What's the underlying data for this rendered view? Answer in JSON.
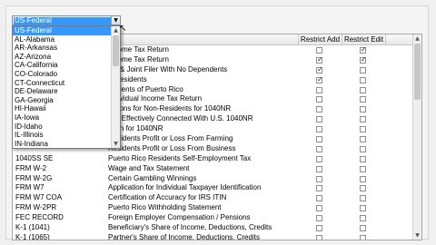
{
  "combo": {
    "selected": "US-Federal",
    "arrow_icon": "chevron-down-icon"
  },
  "dropdown": {
    "items": [
      "US-Federal",
      "AL-Alabama",
      "AR-Arkansas",
      "AZ-Arizona",
      "CA-California",
      "CO-Colorado",
      "CT-Connecticut",
      "DE-Delaware",
      "GA-Georgia",
      "HI-Hawaii",
      "IA-Iowa",
      "ID-Idaho",
      "IL-Illinois",
      "IN-Indiana"
    ],
    "selected_index": 0
  },
  "grid": {
    "headers": {
      "code": "",
      "description": "",
      "restrict_add": "Restrict Add",
      "restrict_edit": "Restrict Edit"
    },
    "rows": [
      {
        "code": "",
        "desc": "Income Tax Return",
        "add": false,
        "edit": true
      },
      {
        "code": "",
        "desc": "Income Tax Return",
        "add": true,
        "edit": true
      },
      {
        "code": "",
        "desc": "gle & Joint Filer With No Dependents",
        "add": true,
        "edit": false
      },
      {
        "code": "",
        "desc": "n-Residents",
        "add": true,
        "edit": false
      },
      {
        "code": "",
        "desc": "esidents of Puerto Rico",
        "add": false,
        "edit": false
      },
      {
        "code": "",
        "desc": "Individual Income Tax Return",
        "add": false,
        "edit": false
      },
      {
        "code": "",
        "desc": "uctions for Non-Residents for 1040NR",
        "add": false,
        "edit": false
      },
      {
        "code": "",
        "desc": "Not Effectively Connected With U.S. 1040NR",
        "add": false,
        "edit": false
      },
      {
        "code": "",
        "desc": "ation for 1040NR",
        "add": false,
        "edit": false
      },
      {
        "code": "",
        "desc": "Residents Profit or Loss From Farming",
        "add": false,
        "edit": false
      },
      {
        "code": "",
        "desc": "Residents Profit or Loss From Business",
        "add": false,
        "edit": false
      },
      {
        "code": "1040SS SE",
        "desc": "Puerto Rico Residents Self-Employment Tax",
        "add": false,
        "edit": false
      },
      {
        "code": "FRM W-2",
        "desc": "Wage and Tax Statement",
        "add": false,
        "edit": false
      },
      {
        "code": "FRM W-2G",
        "desc": "Certain Gambling Winnings",
        "add": false,
        "edit": false
      },
      {
        "code": "FRM W7",
        "desc": "Application for Individual Taxpayer Identification",
        "add": false,
        "edit": false
      },
      {
        "code": "FRM W7 COA",
        "desc": "Certification of Accuracy for IRS ITIN",
        "add": false,
        "edit": false
      },
      {
        "code": "FRM W-2PR",
        "desc": "Puerto Rico Withholding Statement",
        "add": false,
        "edit": false
      },
      {
        "code": "FEC RECORD",
        "desc": "Foreign Employer Compensation / Pensions",
        "add": false,
        "edit": false
      },
      {
        "code": "K-1 (1041)",
        "desc": "Beneficiary's Share of Income, Deductions, Credits",
        "add": false,
        "edit": false
      },
      {
        "code": "K-1 (1065)",
        "desc": "Partner's Share of Income, Deductions, Credits",
        "add": false,
        "edit": false
      }
    ]
  }
}
